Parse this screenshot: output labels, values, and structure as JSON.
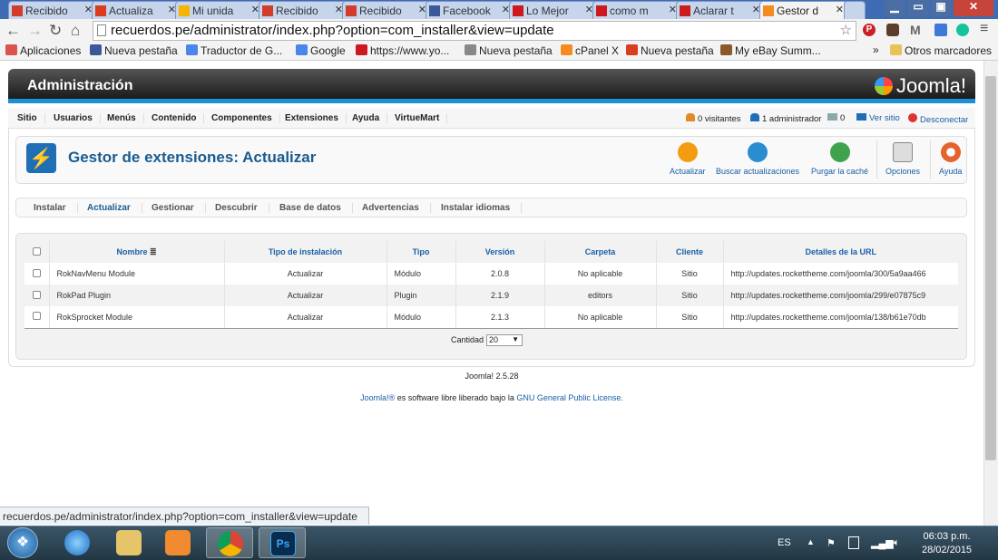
{
  "browser": {
    "tabs": [
      {
        "label": "Recibido",
        "icon": "gmail-icon",
        "color": "#d23c2b"
      },
      {
        "label": "Actualiza",
        "icon": "web-icon",
        "color": "#d93c1f"
      },
      {
        "label": "Mi unida",
        "icon": "drive-icon",
        "color": "#f4b400"
      },
      {
        "label": "Recibido",
        "icon": "gmail-icon",
        "color": "#d23c2b"
      },
      {
        "label": "Recibido",
        "icon": "gmail-icon",
        "color": "#d23c2b"
      },
      {
        "label": "Facebook",
        "icon": "facebook-icon",
        "color": "#3b5998"
      },
      {
        "label": "Lo Mejor",
        "icon": "youtube-icon",
        "color": "#cc181e"
      },
      {
        "label": "como m",
        "icon": "youtube-icon",
        "color": "#cc181e"
      },
      {
        "label": "Aclarar t",
        "icon": "adobe-icon",
        "color": "#cc1b1b"
      },
      {
        "label": "Gestor d",
        "icon": "joomla-icon",
        "color": "#f58a1f"
      }
    ],
    "url": "recuerdos.pe/administrator/index.php?option=com_installer&view=update",
    "bookmarks": [
      {
        "label": "Aplicaciones",
        "color": "#d9534f"
      },
      {
        "label": "Nueva pestaña",
        "color": "#3b5998"
      },
      {
        "label": "Traductor de G...",
        "color": "#4a86e8"
      },
      {
        "label": "Google",
        "color": "#4a86e8"
      },
      {
        "label": "https://www.yo...",
        "color": "#cc181e"
      },
      {
        "label": "Nueva pestaña",
        "color": "#888888"
      },
      {
        "label": "cPanel X",
        "color": "#f58a1f"
      },
      {
        "label": "Nueva pestaña",
        "color": "#d93c1f"
      },
      {
        "label": "My eBay Summ...",
        "color": "#8a5a2b"
      }
    ],
    "other_bookmarks": "Otros marcadores",
    "more": "»",
    "status_url": "recuerdos.pe/administrator/index.php?option=com_installer&view=update"
  },
  "admin": {
    "title": "Administración",
    "logo": "Joomla!",
    "menu": [
      "Sitio",
      "Usuarios",
      "Menús",
      "Contenido",
      "Componentes",
      "Extensiones",
      "Ayuda",
      "VirtueMart"
    ],
    "status": {
      "visitors": "0 visitantes",
      "admins": "1 administrador",
      "messages": "0",
      "view_site": "Ver sitio",
      "logout": "Desconectar"
    },
    "page_title": "Gestor de extensiones: Actualizar",
    "toolbar": {
      "update": "Actualizar",
      "find": "Buscar actualizaciones",
      "purge": "Purgar la caché",
      "options": "Opciones",
      "help": "Ayuda"
    },
    "subnav": [
      "Instalar",
      "Actualizar",
      "Gestionar",
      "Descubrir",
      "Base de datos",
      "Advertencias",
      "Instalar idiomas"
    ],
    "subnav_active": "Actualizar",
    "table": {
      "headers": [
        "Nombre",
        "Tipo de instalación",
        "Tipo",
        "Versión",
        "Carpeta",
        "Cliente",
        "Detalles de la URL"
      ],
      "rows": [
        [
          "RokNavMenu Module",
          "Actualizar",
          "Módulo",
          "2.0.8",
          "No aplicable",
          "Sitio",
          "http://updates.rockettheme.com/joomla/300/5a9aa466"
        ],
        [
          "RokPad Plugin",
          "Actualizar",
          "Plugin",
          "2.1.9",
          "editors",
          "Sitio",
          "http://updates.rockettheme.com/joomla/299/e07875c9"
        ],
        [
          "RokSprocket Module",
          "Actualizar",
          "Módulo",
          "2.1.3",
          "No aplicable",
          "Sitio",
          "http://updates.rockettheme.com/joomla/138/b61e70db"
        ]
      ]
    },
    "limit_label": "Cantidad",
    "limit_value": "20",
    "version": "Joomla! 2.5.28",
    "license_prefix": "Joomla!®",
    "license_mid": "es software libre liberado bajo la",
    "license_link": "GNU General Public License."
  },
  "taskbar": {
    "lang": "ES",
    "time": "06:03 p.m.",
    "date": "28/02/2015"
  }
}
